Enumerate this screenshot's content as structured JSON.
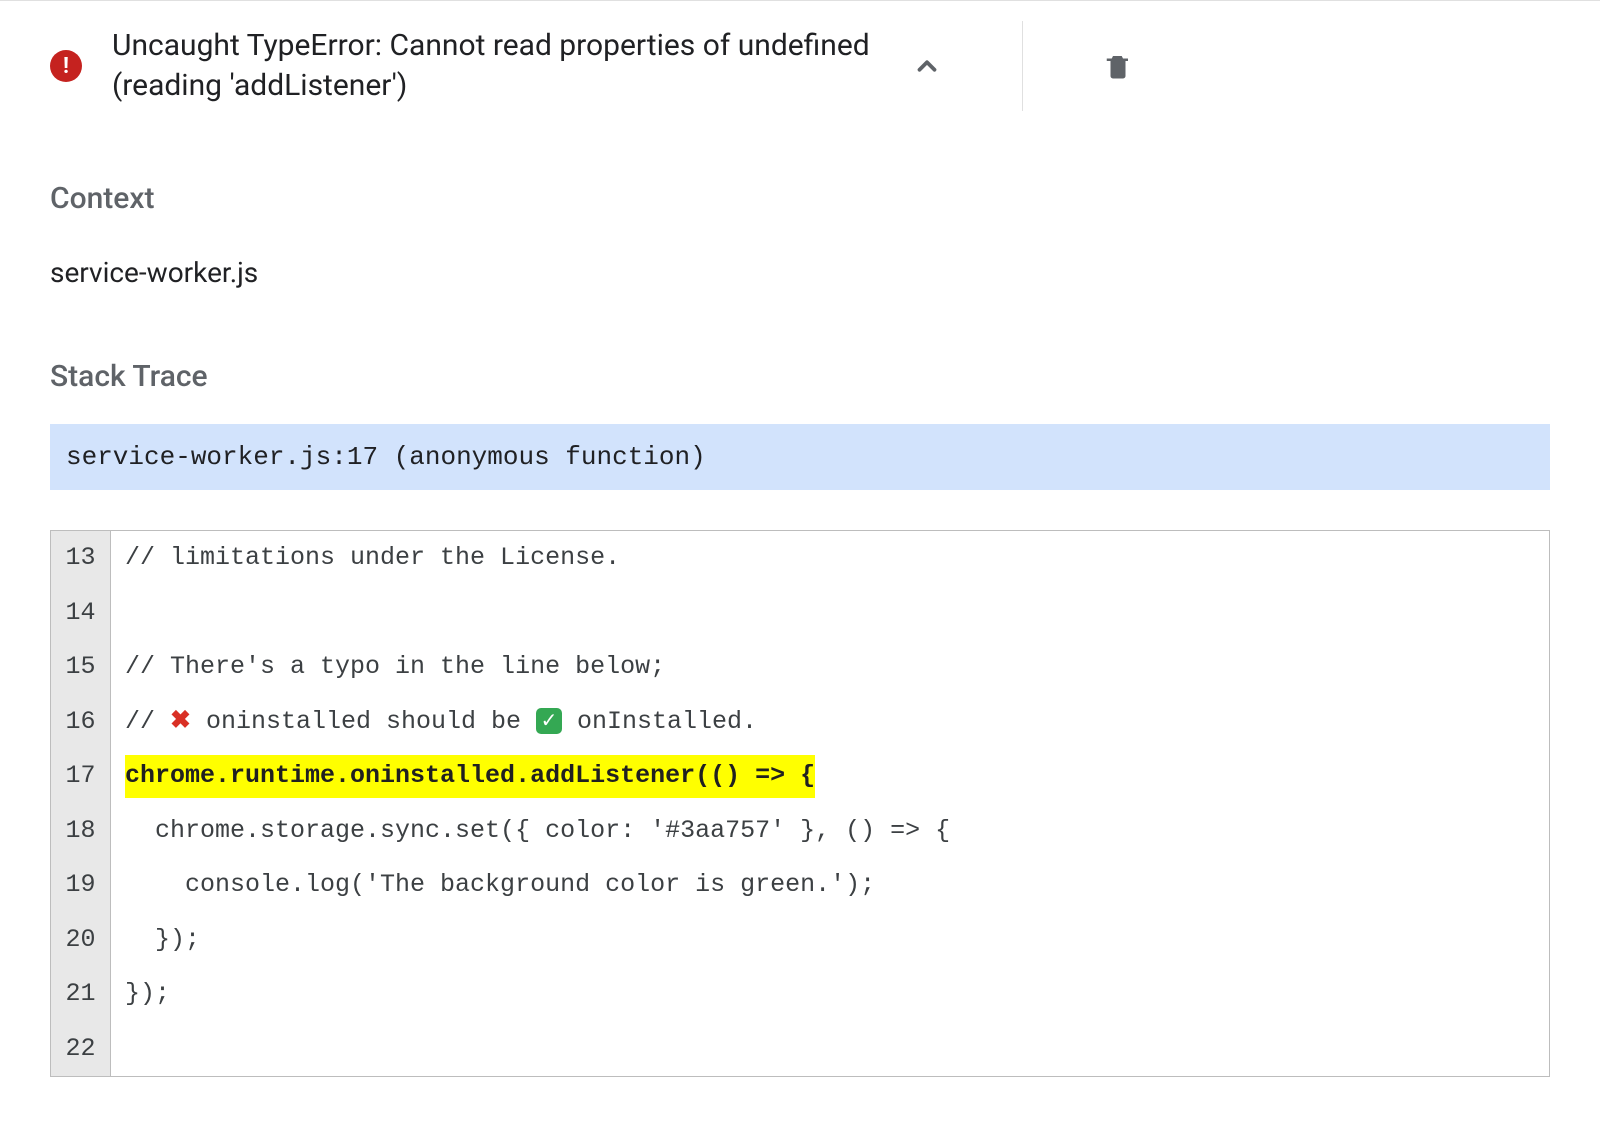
{
  "error": {
    "title": "Uncaught TypeError: Cannot read properties of undefined (reading 'addListener')"
  },
  "sections": {
    "context_heading": "Context",
    "context_file": "service-worker.js",
    "stack_heading": "Stack Trace",
    "stack_frame": "service-worker.js:17 (anonymous function)"
  },
  "code": {
    "lines": [
      {
        "num": "13",
        "text": "// limitations under the License."
      },
      {
        "num": "14",
        "text": ""
      },
      {
        "num": "15",
        "text": "// There's a typo in the line below;"
      },
      {
        "num": "16",
        "prefix": "// ",
        "x": "✖",
        "mid1": " oninstalled should be ",
        "check": "✓",
        "mid2": " onInstalled."
      },
      {
        "num": "17",
        "text": "chrome.runtime.oninstalled.addListener(() => {",
        "highlight": true
      },
      {
        "num": "18",
        "text": "  chrome.storage.sync.set({ color: '#3aa757' }, () => {"
      },
      {
        "num": "19",
        "text": "    console.log('The background color is green.');"
      },
      {
        "num": "20",
        "text": "  });"
      },
      {
        "num": "21",
        "text": "});"
      },
      {
        "num": "22",
        "text": ""
      }
    ]
  },
  "icons": {
    "error_badge": "!",
    "collapse": "chevron-up",
    "delete": "trash"
  }
}
